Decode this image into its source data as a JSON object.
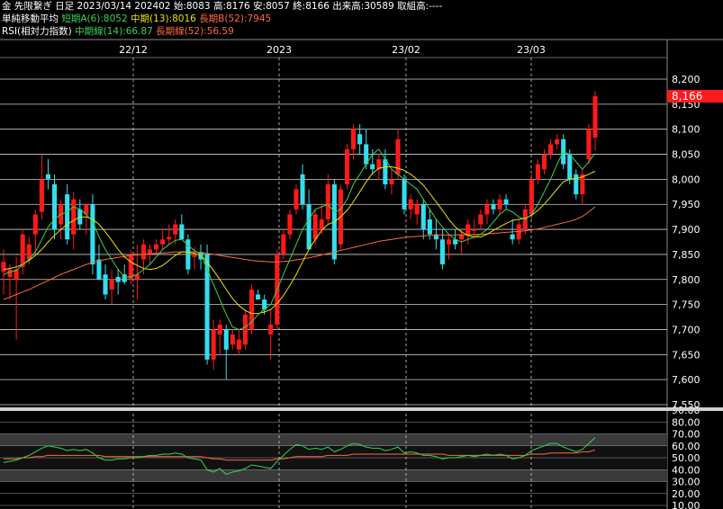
{
  "header": {
    "title": "金 先限繋ぎ 日足",
    "date": "2023/03/14",
    "code": "202402",
    "open_label": "始:8083",
    "high_label": "高:8176",
    "low_label": "安:8057",
    "close_label": "終:8166",
    "volume_label": "出来高:30589",
    "oi_label": "取組高:----",
    "ma_title": "単純移動平均",
    "ma_short": "短期A(6):8052",
    "ma_mid": "中期(13):8016",
    "ma_long": "長期B(52):7945",
    "rsi_title": "RSI(相対力指数)",
    "rsi_mid": "中期線(14):66.87",
    "rsi_long": "長期線(52):56.59"
  },
  "colors": {
    "up": "#ff1a1a",
    "down": "#33ddee",
    "ma_short": "#39d353",
    "ma_mid": "#e6e600",
    "ma_long": "#ff6a3d",
    "rsi_mid": "#39d353",
    "rsi_long": "#ff6a3d",
    "last_price_bg": "#ff1a1a"
  },
  "last_price": "8,166",
  "chart_data": {
    "type": "candlestick",
    "x_labels": [
      "22/12",
      "2023",
      "23/02",
      "23/03"
    ],
    "price_axis": [
      "8,200",
      "8,150",
      "8,100",
      "8,050",
      "8,000",
      "7,950",
      "7,900",
      "7,850",
      "7,800",
      "7,750",
      "7,700",
      "7,650",
      "7,600",
      "7,550"
    ],
    "price_range": [
      7550,
      8200
    ],
    "rsi_axis": [
      "80.00",
      "70.00",
      "60.00",
      "50.00",
      "40.00",
      "30.00",
      "20.00",
      "10.00"
    ],
    "rsi_top_label": "90.00",
    "rsi_range": [
      10,
      90
    ],
    "candles": [
      {
        "o": 7815,
        "h": 7860,
        "l": 7770,
        "c": 7835
      },
      {
        "o": 7805,
        "h": 7830,
        "l": 7760,
        "c": 7820
      },
      {
        "o": 7800,
        "h": 7845,
        "l": 7680,
        "c": 7820
      },
      {
        "o": 7825,
        "h": 7900,
        "l": 7810,
        "c": 7890
      },
      {
        "o": 7840,
        "h": 7885,
        "l": 7830,
        "c": 7870
      },
      {
        "o": 7890,
        "h": 7940,
        "l": 7850,
        "c": 7930
      },
      {
        "o": 7935,
        "h": 8050,
        "l": 7920,
        "c": 8000
      },
      {
        "o": 8010,
        "h": 8040,
        "l": 7980,
        "c": 8000
      },
      {
        "o": 7990,
        "h": 8010,
        "l": 7880,
        "c": 7900
      },
      {
        "o": 7910,
        "h": 7960,
        "l": 7880,
        "c": 7950
      },
      {
        "o": 7970,
        "h": 7990,
        "l": 7870,
        "c": 7880
      },
      {
        "o": 7890,
        "h": 7975,
        "l": 7860,
        "c": 7960
      },
      {
        "o": 7940,
        "h": 7960,
        "l": 7900,
        "c": 7910
      },
      {
        "o": 7930,
        "h": 7950,
        "l": 7890,
        "c": 7950
      },
      {
        "o": 7950,
        "h": 7970,
        "l": 7810,
        "c": 7830
      },
      {
        "o": 7840,
        "h": 7870,
        "l": 7800,
        "c": 7800
      },
      {
        "o": 7810,
        "h": 7830,
        "l": 7760,
        "c": 7770
      },
      {
        "o": 7780,
        "h": 7820,
        "l": 7750,
        "c": 7800
      },
      {
        "o": 7805,
        "h": 7820,
        "l": 7770,
        "c": 7795
      },
      {
        "o": 7810,
        "h": 7830,
        "l": 7790,
        "c": 7795
      },
      {
        "o": 7800,
        "h": 7860,
        "l": 7790,
        "c": 7850
      },
      {
        "o": 7800,
        "h": 7870,
        "l": 7760,
        "c": 7810
      },
      {
        "o": 7840,
        "h": 7880,
        "l": 7810,
        "c": 7870
      },
      {
        "o": 7850,
        "h": 7870,
        "l": 7830,
        "c": 7860
      },
      {
        "o": 7860,
        "h": 7880,
        "l": 7850,
        "c": 7870
      },
      {
        "o": 7870,
        "h": 7900,
        "l": 7860,
        "c": 7880
      },
      {
        "o": 7880,
        "h": 7910,
        "l": 7870,
        "c": 7885
      },
      {
        "o": 7890,
        "h": 7920,
        "l": 7870,
        "c": 7910
      },
      {
        "o": 7910,
        "h": 7930,
        "l": 7880,
        "c": 7880
      },
      {
        "o": 7880,
        "h": 7890,
        "l": 7810,
        "c": 7820
      },
      {
        "o": 7845,
        "h": 7865,
        "l": 7820,
        "c": 7850
      },
      {
        "o": 7855,
        "h": 7870,
        "l": 7820,
        "c": 7840
      },
      {
        "o": 7850,
        "h": 7870,
        "l": 7630,
        "c": 7640
      },
      {
        "o": 7640,
        "h": 7720,
        "l": 7620,
        "c": 7700
      },
      {
        "o": 7690,
        "h": 7720,
        "l": 7650,
        "c": 7710
      },
      {
        "o": 7700,
        "h": 7710,
        "l": 7600,
        "c": 7660
      },
      {
        "o": 7670,
        "h": 7700,
        "l": 7660,
        "c": 7690
      },
      {
        "o": 7660,
        "h": 7700,
        "l": 7650,
        "c": 7680
      },
      {
        "o": 7670,
        "h": 7740,
        "l": 7660,
        "c": 7730
      },
      {
        "o": 7700,
        "h": 7790,
        "l": 7690,
        "c": 7780
      },
      {
        "o": 7770,
        "h": 7780,
        "l": 7760,
        "c": 7760
      },
      {
        "o": 7760,
        "h": 7770,
        "l": 7730,
        "c": 7740
      },
      {
        "o": 7690,
        "h": 7740,
        "l": 7640,
        "c": 7710
      },
      {
        "o": 7710,
        "h": 7860,
        "l": 7700,
        "c": 7850
      },
      {
        "o": 7850,
        "h": 7900,
        "l": 7840,
        "c": 7890
      },
      {
        "o": 7890,
        "h": 7940,
        "l": 7880,
        "c": 7930
      },
      {
        "o": 7940,
        "h": 7990,
        "l": 7930,
        "c": 7980
      },
      {
        "o": 8010,
        "h": 8030,
        "l": 7940,
        "c": 7950
      },
      {
        "o": 7950,
        "h": 7980,
        "l": 7860,
        "c": 7860
      },
      {
        "o": 7880,
        "h": 7940,
        "l": 7870,
        "c": 7930
      },
      {
        "o": 7900,
        "h": 7950,
        "l": 7890,
        "c": 7920
      },
      {
        "o": 7920,
        "h": 8010,
        "l": 7910,
        "c": 7990
      },
      {
        "o": 7990,
        "h": 8000,
        "l": 7830,
        "c": 7840
      },
      {
        "o": 7870,
        "h": 7990,
        "l": 7860,
        "c": 7980
      },
      {
        "o": 7990,
        "h": 8070,
        "l": 7980,
        "c": 8060
      },
      {
        "o": 8060,
        "h": 8110,
        "l": 8040,
        "c": 8100
      },
      {
        "o": 8090,
        "h": 8110,
        "l": 8050,
        "c": 8070
      },
      {
        "o": 8070,
        "h": 8100,
        "l": 8020,
        "c": 8030
      },
      {
        "o": 8030,
        "h": 8060,
        "l": 8010,
        "c": 8020
      },
      {
        "o": 8020,
        "h": 8050,
        "l": 8000,
        "c": 8040
      },
      {
        "o": 8040,
        "h": 8060,
        "l": 7980,
        "c": 7990
      },
      {
        "o": 7990,
        "h": 8020,
        "l": 7970,
        "c": 8000
      },
      {
        "o": 8010,
        "h": 8100,
        "l": 8000,
        "c": 8080
      },
      {
        "o": 8000,
        "h": 8010,
        "l": 7930,
        "c": 7940
      },
      {
        "o": 7940,
        "h": 7970,
        "l": 7920,
        "c": 7960
      },
      {
        "o": 7930,
        "h": 7960,
        "l": 7910,
        "c": 7950
      },
      {
        "o": 7950,
        "h": 7960,
        "l": 7880,
        "c": 7900
      },
      {
        "o": 7920,
        "h": 7940,
        "l": 7880,
        "c": 7890
      },
      {
        "o": 7890,
        "h": 7920,
        "l": 7860,
        "c": 7880
      },
      {
        "o": 7880,
        "h": 7900,
        "l": 7820,
        "c": 7830
      },
      {
        "o": 7870,
        "h": 7890,
        "l": 7840,
        "c": 7880
      },
      {
        "o": 7880,
        "h": 7900,
        "l": 7860,
        "c": 7870
      },
      {
        "o": 7880,
        "h": 7900,
        "l": 7850,
        "c": 7890
      },
      {
        "o": 7890,
        "h": 7920,
        "l": 7870,
        "c": 7910
      },
      {
        "o": 7900,
        "h": 7920,
        "l": 7880,
        "c": 7900
      },
      {
        "o": 7910,
        "h": 7940,
        "l": 7900,
        "c": 7930
      },
      {
        "o": 7930,
        "h": 7960,
        "l": 7910,
        "c": 7950
      },
      {
        "o": 7950,
        "h": 7960,
        "l": 7930,
        "c": 7940
      },
      {
        "o": 7940,
        "h": 7970,
        "l": 7930,
        "c": 7960
      },
      {
        "o": 7960,
        "h": 7970,
        "l": 7940,
        "c": 7950
      },
      {
        "o": 7890,
        "h": 7920,
        "l": 7870,
        "c": 7880
      },
      {
        "o": 7880,
        "h": 7920,
        "l": 7870,
        "c": 7910
      },
      {
        "o": 7900,
        "h": 7950,
        "l": 7890,
        "c": 7940
      },
      {
        "o": 7930,
        "h": 8010,
        "l": 7920,
        "c": 8000
      },
      {
        "o": 8000,
        "h": 8040,
        "l": 7990,
        "c": 8030
      },
      {
        "o": 8020,
        "h": 8060,
        "l": 8010,
        "c": 8050
      },
      {
        "o": 8050,
        "h": 8080,
        "l": 8040,
        "c": 8070
      },
      {
        "o": 8070,
        "h": 8090,
        "l": 8060,
        "c": 8080
      },
      {
        "o": 8080,
        "h": 8090,
        "l": 8020,
        "c": 8030
      },
      {
        "o": 8050,
        "h": 8060,
        "l": 7990,
        "c": 8000
      },
      {
        "o": 8010,
        "h": 8020,
        "l": 7960,
        "c": 7970
      },
      {
        "o": 7970,
        "h": 8020,
        "l": 7950,
        "c": 8010
      },
      {
        "o": 8040,
        "h": 8110,
        "l": 8030,
        "c": 8100
      },
      {
        "o": 8083,
        "h": 8176,
        "l": 8057,
        "c": 8166
      }
    ],
    "ma_short": [
      7810,
      7815,
      7818,
      7830,
      7840,
      7855,
      7880,
      7905,
      7920,
      7930,
      7935,
      7945,
      7940,
      7930,
      7915,
      7885,
      7860,
      7840,
      7820,
      7805,
      7805,
      7810,
      7820,
      7830,
      7845,
      7860,
      7870,
      7878,
      7880,
      7868,
      7858,
      7850,
      7820,
      7790,
      7760,
      7730,
      7705,
      7700,
      7705,
      7715,
      7730,
      7740,
      7750,
      7780,
      7810,
      7840,
      7870,
      7900,
      7920,
      7940,
      7945,
      7950,
      7935,
      7940,
      7960,
      7990,
      8010,
      8030,
      8050,
      8060,
      8040,
      8020,
      8010,
      8000,
      7990,
      7980,
      7960,
      7940,
      7920,
      7905,
      7890,
      7880,
      7875,
      7880,
      7885,
      7890,
      7900,
      7915,
      7930,
      7940,
      7935,
      7925,
      7920,
      7930,
      7950,
      7975,
      8000,
      8030,
      8055,
      8050,
      8035,
      8020,
      8035,
      8052
    ],
    "ma_mid": [
      7820,
      7822,
      7825,
      7830,
      7838,
      7848,
      7860,
      7875,
      7888,
      7900,
      7910,
      7918,
      7925,
      7925,
      7920,
      7910,
      7895,
      7878,
      7860,
      7845,
      7835,
      7828,
      7822,
      7820,
      7822,
      7828,
      7838,
      7848,
      7855,
      7855,
      7852,
      7848,
      7835,
      7818,
      7800,
      7780,
      7762,
      7748,
      7738,
      7732,
      7732,
      7735,
      7740,
      7752,
      7768,
      7788,
      7810,
      7835,
      7860,
      7880,
      7898,
      7910,
      7915,
      7925,
      7938,
      7955,
      7975,
      7995,
      8012,
      8022,
      8025,
      8025,
      8022,
      8018,
      8010,
      8000,
      7988,
      7972,
      7955,
      7938,
      7920,
      7905,
      7895,
      7888,
      7885,
      7885,
      7890,
      7898,
      7905,
      7912,
      7918,
      7920,
      7922,
      7928,
      7938,
      7950,
      7965,
      7980,
      7995,
      8000,
      8002,
      8005,
      8010,
      8016
    ],
    "ma_long": [
      7760,
      7765,
      7770,
      7775,
      7780,
      7786,
      7792,
      7798,
      7804,
      7810,
      7815,
      7820,
      7825,
      7830,
      7834,
      7837,
      7840,
      7842,
      7844,
      7846,
      7848,
      7849,
      7850,
      7851,
      7852,
      7853,
      7854,
      7855,
      7855,
      7855,
      7855,
      7854,
      7852,
      7850,
      7848,
      7846,
      7844,
      7842,
      7840,
      7838,
      7837,
      7836,
      7835,
      7835,
      7836,
      7837,
      7839,
      7841,
      7843,
      7846,
      7849,
      7852,
      7855,
      7858,
      7861,
      7864,
      7867,
      7870,
      7873,
      7876,
      7878,
      7880,
      7882,
      7884,
      7885,
      7886,
      7887,
      7888,
      7889,
      7889,
      7889,
      7889,
      7889,
      7889,
      7890,
      7890,
      7891,
      7892,
      7893,
      7894,
      7895,
      7896,
      7897,
      7899,
      7901,
      7904,
      7907,
      7910,
      7913,
      7916,
      7920,
      7926,
      7935,
      7945
    ],
    "rsi_mid": [
      46,
      47,
      48,
      50,
      52,
      55,
      58,
      60,
      59,
      58,
      56,
      57,
      56,
      57,
      54,
      50,
      48,
      48,
      49,
      49,
      50,
      50,
      51,
      52,
      52,
      53,
      53,
      54,
      53,
      50,
      49,
      48,
      40,
      38,
      41,
      36,
      38,
      39,
      41,
      44,
      43,
      42,
      41,
      47,
      52,
      57,
      61,
      60,
      57,
      58,
      57,
      59,
      55,
      57,
      60,
      62,
      61,
      59,
      58,
      58,
      56,
      57,
      59,
      54,
      55,
      54,
      52,
      52,
      51,
      49,
      50,
      50,
      51,
      52,
      51,
      52,
      53,
      52,
      53,
      52,
      49,
      50,
      52,
      56,
      58,
      60,
      62,
      62,
      59,
      57,
      55,
      57,
      62,
      66.87
    ],
    "rsi_long": [
      49,
      49,
      49,
      50,
      50,
      51,
      51,
      52,
      52,
      52,
      52,
      52,
      52,
      52,
      52,
      52,
      51,
      51,
      51,
      51,
      51,
      51,
      51,
      51,
      51,
      51,
      51,
      51,
      51,
      51,
      51,
      51,
      50,
      49,
      49,
      48,
      48,
      48,
      48,
      48,
      48,
      48,
      48,
      49,
      49,
      50,
      51,
      51,
      51,
      51,
      51,
      52,
      52,
      52,
      52,
      53,
      53,
      53,
      53,
      53,
      53,
      53,
      53,
      53,
      53,
      53,
      53,
      53,
      53,
      53,
      52,
      52,
      52,
      52,
      52,
      52,
      52,
      52,
      52,
      52,
      52,
      52,
      52,
      53,
      53,
      53,
      54,
      54,
      54,
      54,
      54,
      55,
      55,
      56.59
    ]
  }
}
